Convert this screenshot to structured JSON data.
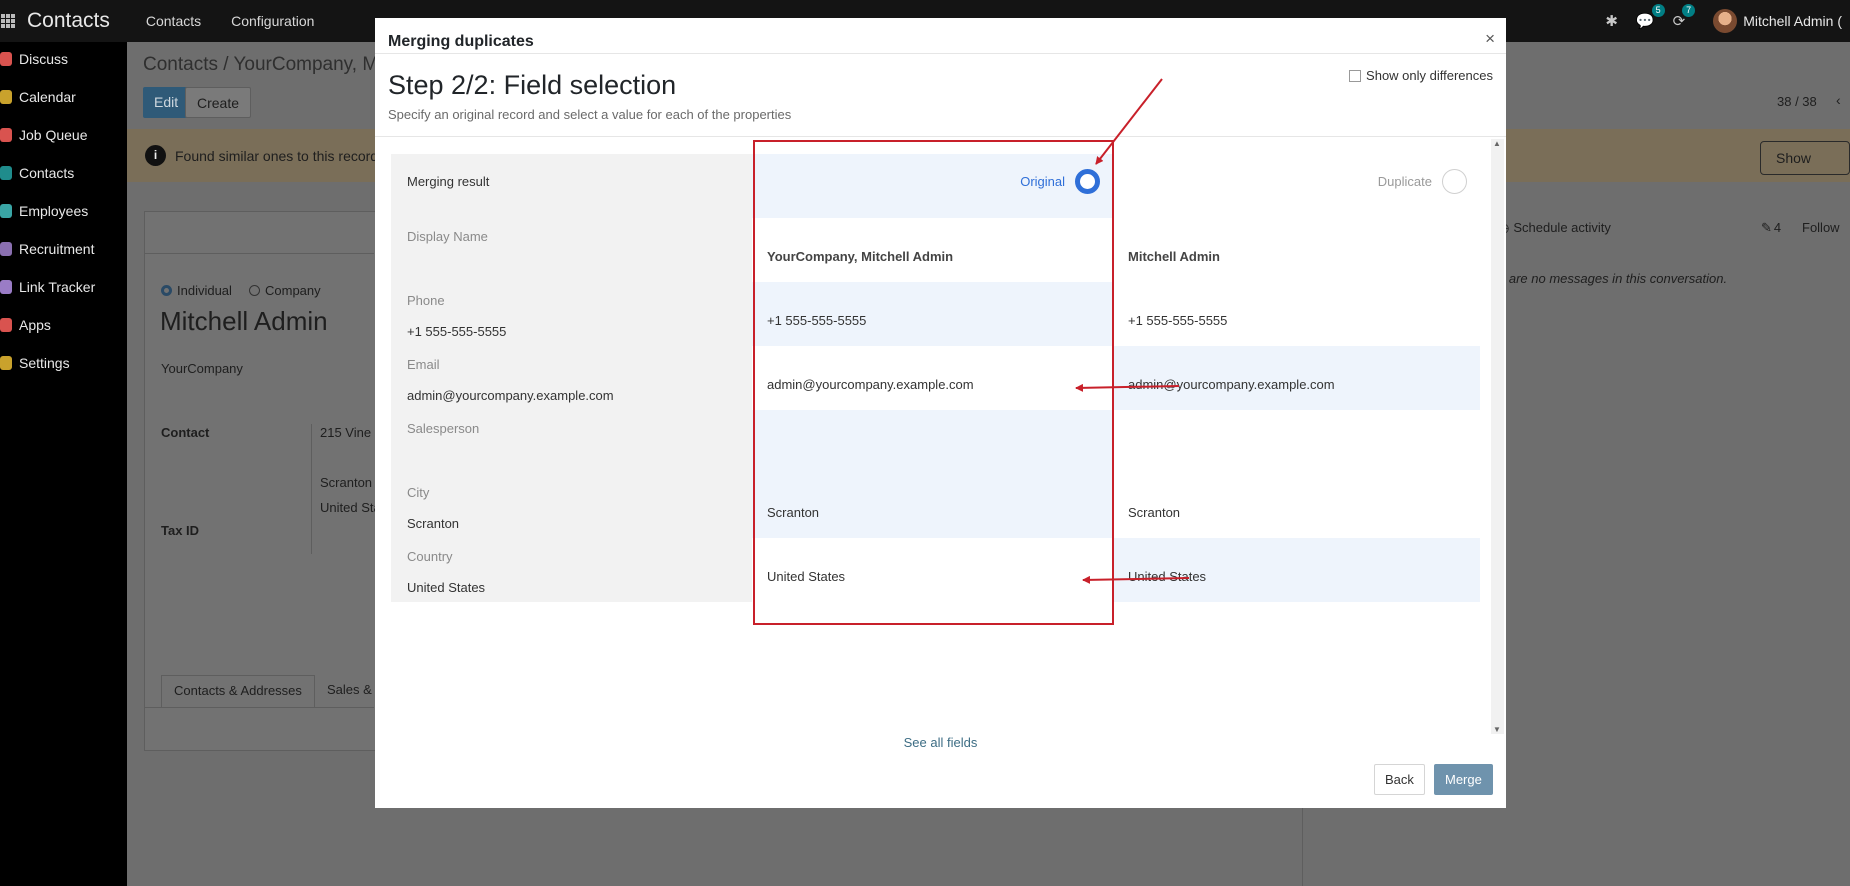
{
  "topbar": {
    "app_name": "Contacts",
    "menu": [
      "Contacts",
      "Configuration"
    ],
    "chat_badge": "5",
    "activity_badge": "7",
    "user_name": "Mitchell Admin ("
  },
  "sidebar": {
    "items": [
      {
        "label": "Discuss",
        "color": "#d9534f"
      },
      {
        "label": "Calendar",
        "color": "#c9a22c"
      },
      {
        "label": "Job Queue",
        "color": "#d9534f"
      },
      {
        "label": "Contacts",
        "color": "#1f8c8c"
      },
      {
        "label": "Employees",
        "color": "#3aa6a6"
      },
      {
        "label": "Recruitment",
        "color": "#8a6fb0"
      },
      {
        "label": "Link Tracker",
        "color": "#9a7cc6"
      },
      {
        "label": "Apps",
        "color": "#d9534f"
      },
      {
        "label": "Settings",
        "color": "#c9a22c"
      }
    ]
  },
  "background": {
    "breadcrumb": "Contacts / YourCompany, Mit",
    "edit_label": "Edit",
    "create_label": "Create",
    "pager": "38 / 38",
    "alert_text": "Found similar ones to this record",
    "show_duplicates": "Show duplica",
    "individual": "Individual",
    "company": "Company",
    "name": "Mitchell Admin",
    "company_name": "YourCompany",
    "contact_label": "Contact",
    "address_1": "215 Vine S",
    "address_2": "Scranton",
    "address_3": "United Stat",
    "tax_label": "Tax ID",
    "tab_1": "Contacts & Addresses",
    "tab_2": "Sales & P",
    "schedule_activity": "Schedule activity",
    "attachments": "4",
    "follow": "Follow",
    "no_messages": "e are no messages in this conversation."
  },
  "modal": {
    "title": "Merging duplicates",
    "close": "×",
    "step_title": "Step 2/2: Field selection",
    "step_subtitle": "Specify an original record and select a value for each of the properties",
    "only_differences": "Show only differences",
    "merging_result": "Merging result",
    "original": "Original",
    "duplicate": "Duplicate",
    "see_all": "See all fields",
    "back": "Back",
    "merge": "Merge",
    "accent": "#2f6fd8",
    "highlight": "#c8202a",
    "rows": [
      {
        "label": "Display Name",
        "current": "",
        "original": "YourCompany, Mitchell Admin",
        "duplicate": "Mitchell Admin"
      },
      {
        "label": "Phone",
        "current": "+1 555-555-5555",
        "original": "+1 555-555-5555",
        "duplicate": "+1 555-555-5555"
      },
      {
        "label": "Email",
        "current": "admin@yourcompany.example.com",
        "original": "admin@yourcompany.example.com",
        "duplicate": "admin@yourcompany.example.com"
      },
      {
        "label": "Salesperson",
        "current": "",
        "original": "",
        "duplicate": ""
      },
      {
        "label": "City",
        "current": "Scranton",
        "original": "Scranton",
        "duplicate": "Scranton"
      },
      {
        "label": "Country",
        "current": "United States",
        "original": "United States",
        "duplicate": "United States"
      }
    ]
  }
}
